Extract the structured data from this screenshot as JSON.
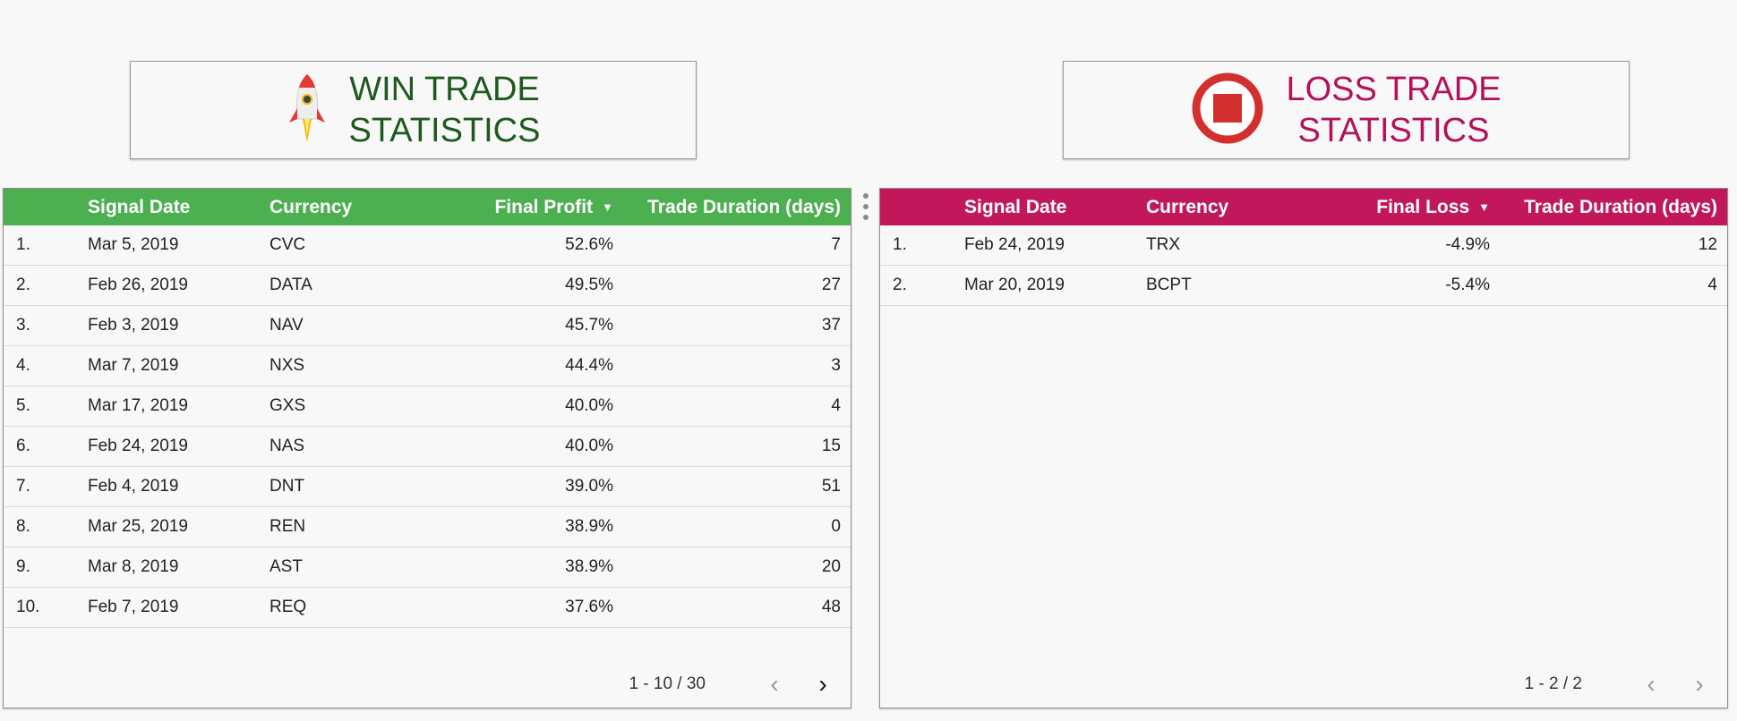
{
  "win": {
    "title_line1": "WIN TRADE",
    "title_line2": "STATISTICS",
    "icon": "rocket-icon",
    "header_color": "#4caf50",
    "columns": [
      "Signal Date",
      "Currency",
      "Final Profit",
      "Trade Duration (days)"
    ],
    "sort_indicator": "▼",
    "rows": [
      {
        "idx": "1.",
        "date": "Mar 5, 2019",
        "currency": "CVC",
        "value": "52.6%",
        "duration": "7"
      },
      {
        "idx": "2.",
        "date": "Feb 26, 2019",
        "currency": "DATA",
        "value": "49.5%",
        "duration": "27"
      },
      {
        "idx": "3.",
        "date": "Feb 3, 2019",
        "currency": "NAV",
        "value": "45.7%",
        "duration": "37"
      },
      {
        "idx": "4.",
        "date": "Mar 7, 2019",
        "currency": "NXS",
        "value": "44.4%",
        "duration": "3"
      },
      {
        "idx": "5.",
        "date": "Mar 17, 2019",
        "currency": "GXS",
        "value": "40.0%",
        "duration": "4"
      },
      {
        "idx": "6.",
        "date": "Feb 24, 2019",
        "currency": "NAS",
        "value": "40.0%",
        "duration": "15"
      },
      {
        "idx": "7.",
        "date": "Feb 4, 2019",
        "currency": "DNT",
        "value": "39.0%",
        "duration": "51"
      },
      {
        "idx": "8.",
        "date": "Mar 25, 2019",
        "currency": "REN",
        "value": "38.9%",
        "duration": "0"
      },
      {
        "idx": "9.",
        "date": "Mar 8, 2019",
        "currency": "AST",
        "value": "38.9%",
        "duration": "20"
      },
      {
        "idx": "10.",
        "date": "Feb 7, 2019",
        "currency": "REQ",
        "value": "37.6%",
        "duration": "48"
      }
    ],
    "pager": {
      "range": "1 - 10 / 30",
      "prev": "‹",
      "next": "›"
    }
  },
  "loss": {
    "title_line1": "LOSS TRADE",
    "title_line2": "STATISTICS",
    "icon": "stop-icon",
    "header_color": "#c2185b",
    "columns": [
      "Signal Date",
      "Currency",
      "Final Loss",
      "Trade Duration (days)"
    ],
    "sort_indicator": "▼",
    "rows": [
      {
        "idx": "1.",
        "date": "Feb 24, 2019",
        "currency": "TRX",
        "value": "-4.9%",
        "duration": "12"
      },
      {
        "idx": "2.",
        "date": "Mar 20, 2019",
        "currency": "BCPT",
        "value": "-5.4%",
        "duration": "4"
      }
    ],
    "pager": {
      "range": "1 - 2 / 2",
      "prev": "‹",
      "next": "›"
    }
  }
}
